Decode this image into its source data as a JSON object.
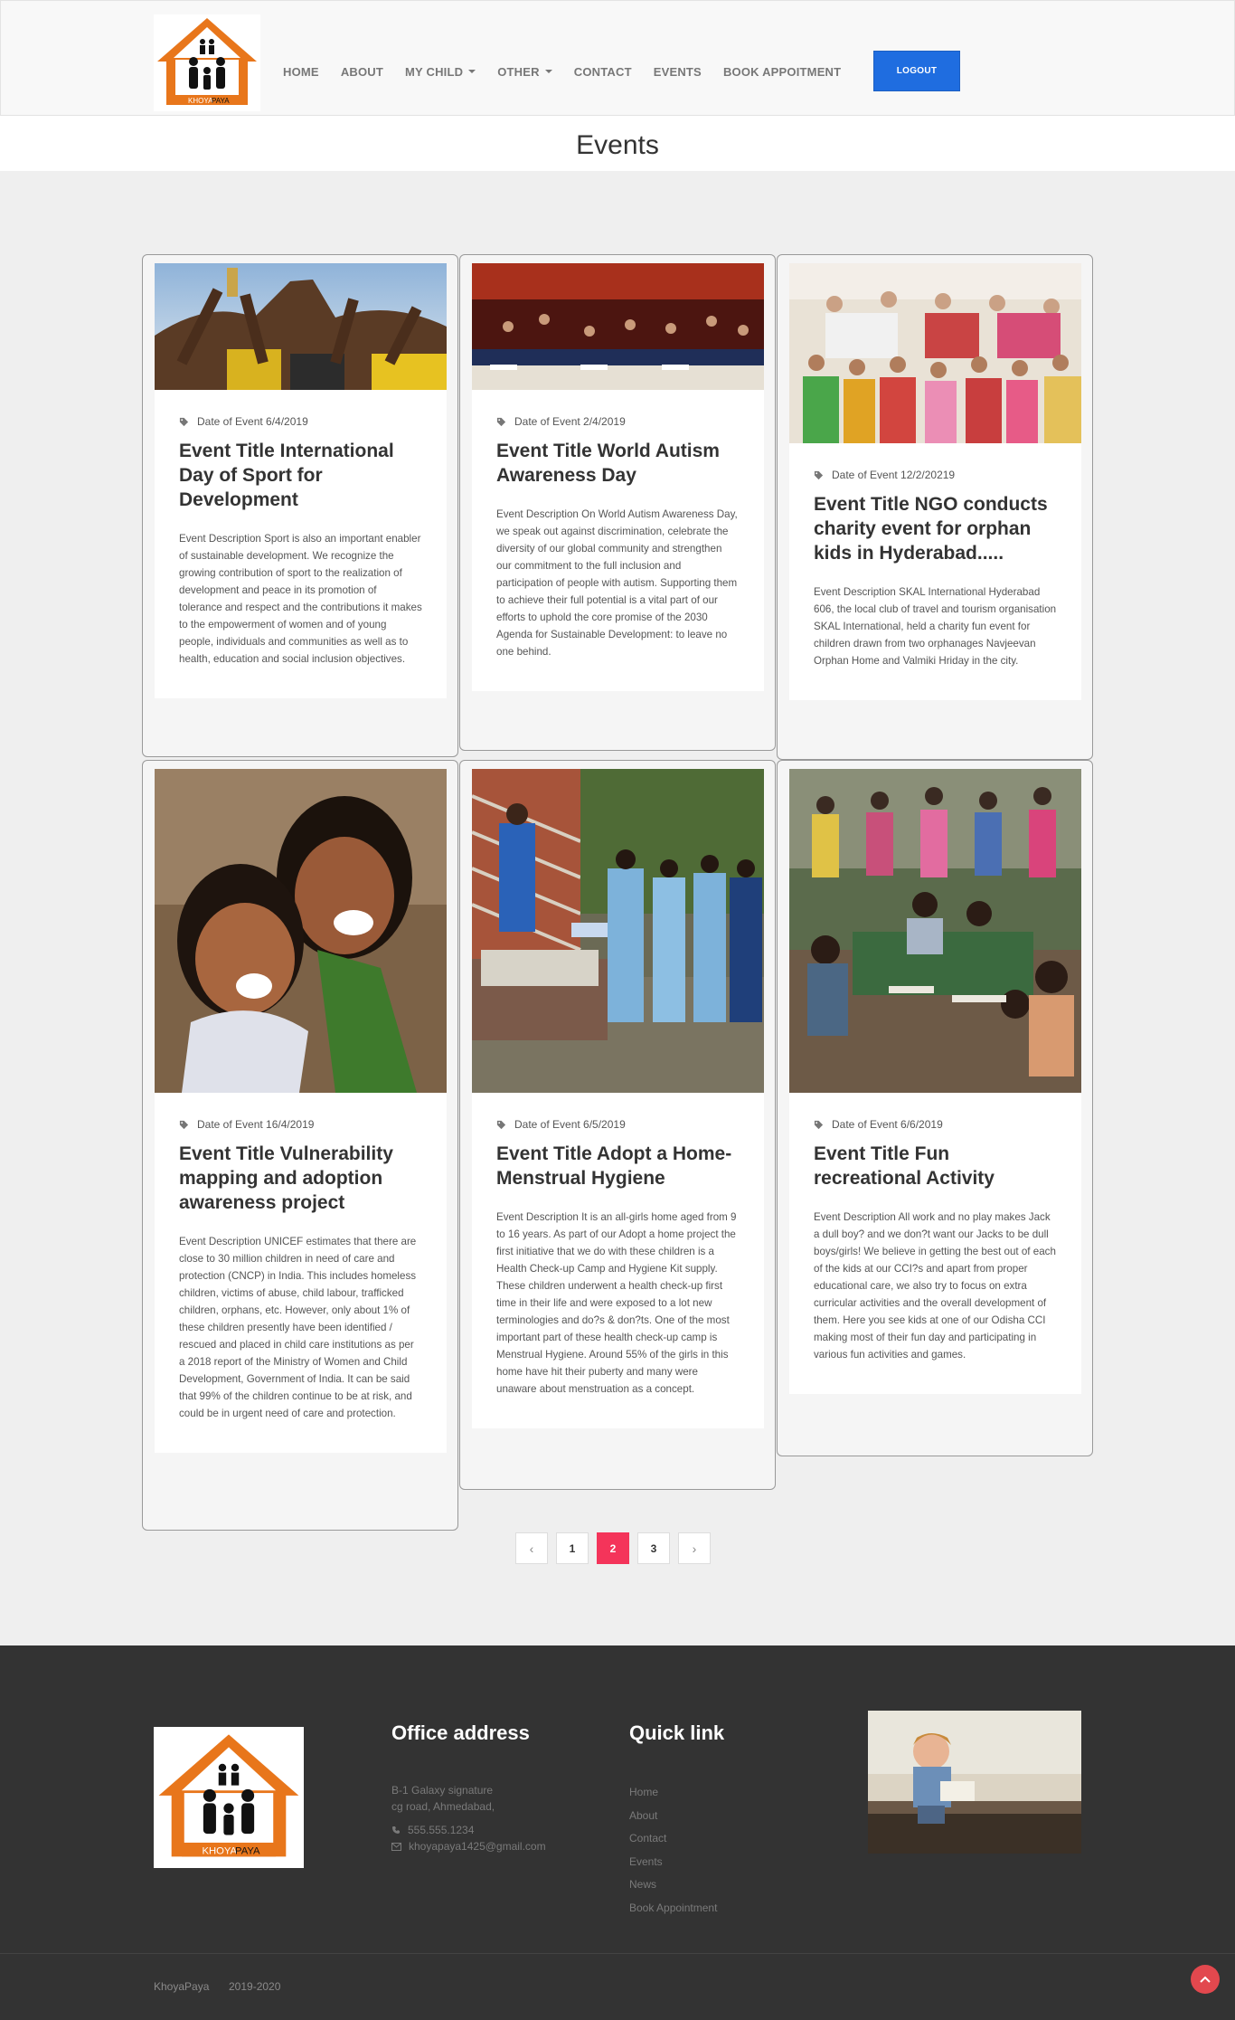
{
  "brand": {
    "logo_text_left": "KHOYA",
    "logo_text_right": "PAYA"
  },
  "nav": {
    "items": [
      {
        "label": "HOME"
      },
      {
        "label": "ABOUT"
      },
      {
        "label": "MY CHILD",
        "dropdown": true
      },
      {
        "label": "OTHER",
        "dropdown": true
      },
      {
        "label": "CONTACT"
      },
      {
        "label": "EVENTS"
      },
      {
        "label": "BOOK APPOITMENT"
      }
    ],
    "logout_label": "LOGOUT"
  },
  "page": {
    "title": "Events"
  },
  "events": [
    {
      "date": "Date of Event 6/4/2019",
      "title": "Event Title International Day of Sport for Development",
      "description": "Event Description Sport is also an important enabler of sustainable development. We recognize the growing contribution of sport to the realization of development and peace in its promotion of tolerance and respect and the contributions it makes to the empowerment of women and of young people, individuals and communities as well as to health, education and social inclusion objectives.",
      "image": "raised-hands-trophy-photo"
    },
    {
      "date": "Date of Event 2/4/2019",
      "title": "Event Title World Autism Awareness Day",
      "description": "Event Description On World Autism Awareness Day, we speak out against discrimination, celebrate the diversity of our global community and strengthen our commitment to the full inclusion and participation of people with autism. Supporting them to achieve their full potential is a vital part of our efforts to uphold the core promise of the 2030 Agenda for Sustainable Development: to leave no one behind.",
      "image": "assembly-hall-photo"
    },
    {
      "date": "Date of Event 12/2/20219",
      "title": "Event Title NGO conducts charity event for orphan kids in Hyderabad.....",
      "description": "Event Description SKAL International Hyderabad 606, the local club of travel and tourism organisation SKAL International, held a charity fun event for children drawn from two orphanages Navjeevan Orphan Home and Valmiki Hriday in the city.",
      "image": "group-of-kids-photo"
    },
    {
      "date": "Date of Event 16/4/2019",
      "title": "Event Title Vulnerability mapping and adoption awareness project",
      "description": "Event Description UNICEF estimates that there are close to 30 million children in need of care and protection (CNCP) in India. This includes homeless children, victims of abuse, child labour, trafficked children, orphans, etc. However, only about 1% of these children presently have been identified / rescued and placed in child care institutions as per a 2018 report of the Ministry of Women and Child Development, Government of India. It can be said that 99% of the children continue to be at risk, and could be in urgent need of care and protection.",
      "image": "laughing-children-photo"
    },
    {
      "date": "Date of Event 6/5/2019",
      "title": "Event Title Adopt a Home-Menstrual Hygiene",
      "description": "Event Description It is an all-girls home aged from 9 to 16 years. As part of our Adopt a home project the first initiative that we do with these children is a Health Check-up Camp and Hygiene Kit supply. These children underwent a health check-up first time in their life and were exposed to a lot new terminologies and do?s & don?ts. One of the most important part of these health check-up camp is Menstrual Hygiene. Around 55% of the girls in this home have hit their puberty and many were unaware about menstruation as a concept.",
      "image": "hygiene-kit-distribution-photo"
    },
    {
      "date": "Date of Event 6/6/2019",
      "title": "Event Title Fun recreational Activity",
      "description": "Event Description All work and no play makes Jack a dull boy? and we don?t want our Jacks to be dull boys/girls! We believe in getting the best out of each of the kids at our CCI?s and apart from proper educational care, we also try to focus on extra curricular activities and the overall development of them. Here you see kids at one of our Odisha CCI making most of their fun day and participating in various fun activities and games.",
      "image": "kids-playing-photo"
    }
  ],
  "pagination": {
    "prev": "‹",
    "pages": [
      "1",
      "2",
      "3"
    ],
    "current": "2",
    "next": "›"
  },
  "footer": {
    "office_heading": "Office address",
    "address_line1": "B-1 Galaxy signature",
    "address_line2": "cg road, Ahmedabad,",
    "phone": "555.555.1234",
    "email": "khoyapaya1425@gmail.com",
    "quick_heading": "Quick link",
    "links": [
      "Home",
      "About",
      "Contact",
      "Events",
      "News",
      "Book Appointment"
    ],
    "copyright": "KhoyaPaya",
    "year": "2019-2020",
    "photo": "child-reading-photo"
  },
  "colors": {
    "accent": "#f4345a",
    "logout": "#1f6de0",
    "logo_orange": "#e8761b",
    "footer_bg": "#333333"
  }
}
